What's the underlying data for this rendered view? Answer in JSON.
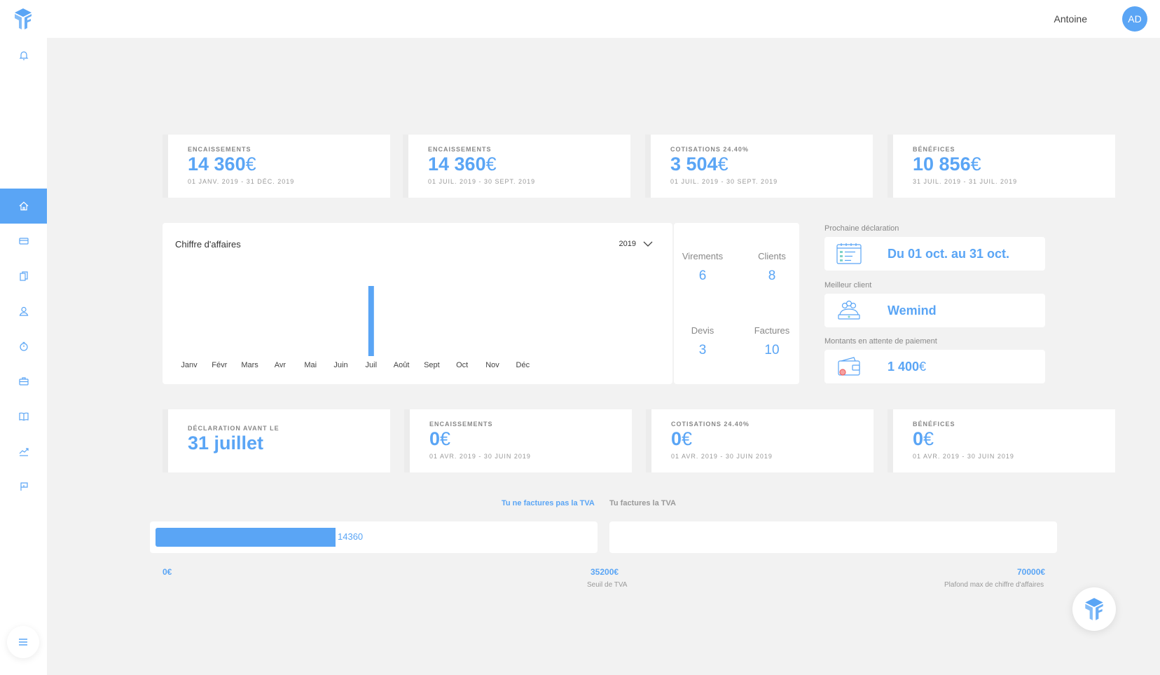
{
  "user": {
    "name": "Antoine",
    "initials": "AD"
  },
  "sidebar": {
    "items": [
      {
        "icon": "bell-icon"
      },
      {
        "icon": "home-icon",
        "active": true
      },
      {
        "icon": "card-icon"
      },
      {
        "icon": "documents-icon"
      },
      {
        "icon": "user-icon"
      },
      {
        "icon": "timer-icon"
      },
      {
        "icon": "briefcase-icon"
      },
      {
        "icon": "book-icon"
      },
      {
        "icon": "trend-icon"
      },
      {
        "icon": "flag-icon"
      }
    ]
  },
  "stats_top": [
    {
      "label": "ENCAISSEMENTS",
      "value": "14 360",
      "currency": "€",
      "range": "01 JANV. 2019 - 31 DÉC. 2019"
    },
    {
      "label": "ENCAISSEMENTS",
      "value": "14 360",
      "currency": "€",
      "range": "01 JUIL. 2019 - 30 SEPT. 2019"
    },
    {
      "label": "COTISATIONS 24.40%",
      "value": "3 504",
      "currency": "€",
      "range": "01 JUIL. 2019 - 30 SEPT. 2019"
    },
    {
      "label": "BÉNÉFICES",
      "value": "10 856",
      "currency": "€",
      "range": "31 JUIL. 2019 - 31 JUIL. 2019"
    }
  ],
  "chart": {
    "title": "Chiffre d'affaires",
    "year": "2019"
  },
  "chart_data": {
    "type": "bar",
    "title": "Chiffre d'affaires",
    "categories": [
      "Janv",
      "Févr",
      "Mars",
      "Avr",
      "Mai",
      "Juin",
      "Juil",
      "Août",
      "Sept",
      "Oct",
      "Nov",
      "Déc"
    ],
    "values": [
      0,
      0,
      0,
      0,
      0,
      0,
      14360,
      0,
      0,
      0,
      0,
      0
    ],
    "xlabel": "",
    "ylabel": "",
    "grid": false,
    "color": "#5aa5f5"
  },
  "counts": [
    {
      "label": "Virements",
      "value": "6"
    },
    {
      "label": "Clients",
      "value": "8"
    },
    {
      "label": "Devis",
      "value": "3"
    },
    {
      "label": "Factures",
      "value": "10"
    }
  ],
  "info": {
    "next_declaration": {
      "label": "Prochaine déclaration",
      "value": "Du 01 oct. au 31 oct."
    },
    "best_client": {
      "label": "Meilleur client",
      "value": "Wemind"
    },
    "pending": {
      "label": "Montants en attente de paiement",
      "value": "1 400",
      "currency": "€"
    }
  },
  "declaration": {
    "label": "DÉCLARATION AVANT LE",
    "value": "31 juillet"
  },
  "stats_bottom": [
    {
      "label": "ENCAISSEMENTS",
      "value": "0",
      "currency": "€",
      "range": "01 AVR. 2019 - 30 JUIN 2019"
    },
    {
      "label": "COTISATIONS 24.40%",
      "value": "0",
      "currency": "€",
      "range": "01 AVR. 2019 - 30 JUIN 2019"
    },
    {
      "label": "BÉNÉFICES",
      "value": "0",
      "currency": "€",
      "range": "01 AVR. 2019 - 30 JUIN 2019"
    }
  ],
  "tva": {
    "tab_no_tva": "Tu ne factures pas la TVA",
    "tab_tva": "Tu factures la TVA",
    "current_value": "14360",
    "progress": 14360,
    "threshold": 35200,
    "max": 70000,
    "scale_min": "0€",
    "scale_threshold": "35200€",
    "scale_threshold_label": "Seuil de TVA",
    "scale_max": "70000€",
    "scale_max_label": "Plafond max de chiffre d'affaires"
  },
  "colors": {
    "accent": "#5aa5f5",
    "background": "#f2f2f2"
  }
}
